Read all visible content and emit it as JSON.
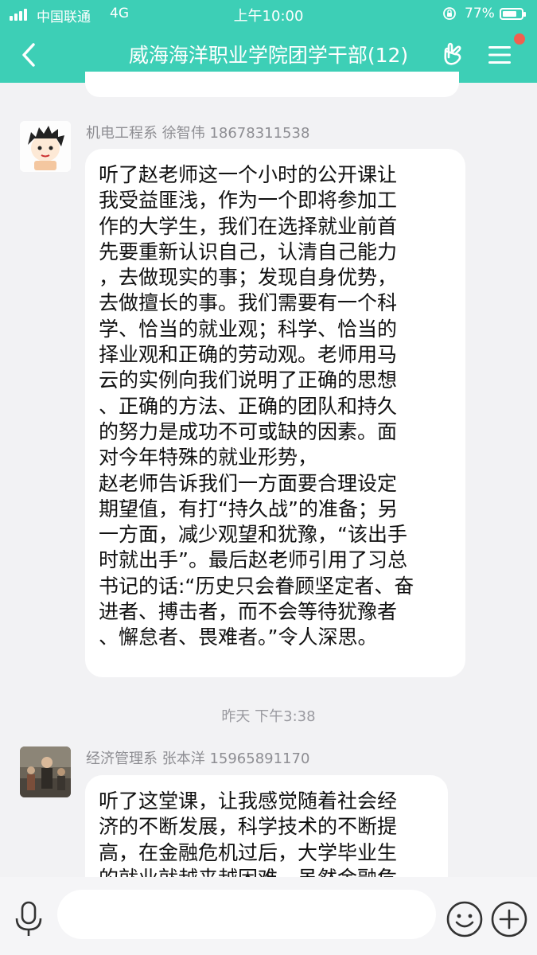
{
  "status_bar": {
    "carrier": "中国联通",
    "network": "4G",
    "time": "上午10:00",
    "battery": "77%",
    "battery_level": 0.77
  },
  "header": {
    "title": "威海海洋职业学院团学干部(12)",
    "icons": [
      "back-arrow-icon",
      "hand-gesture-icon",
      "menu-icon"
    ],
    "accent_color": "#3dcfb6",
    "badge_color": "#f0604f"
  },
  "messages": [
    {
      "sender": "机电工程系 徐智伟 18678311538",
      "lines": [
        "听了赵老师这一个小时的公开课让",
        "我受益匪浅，作为一个即将参加工",
        "作的大学生，我们在选择就业前首",
        "先要重新认识自己，认清自己能力",
        "，去做现实的事；发现自身优势，",
        "去做擅长的事。我们需要有一个科",
        "学、恰当的就业观；科学、恰当的",
        "择业观和正确的劳动观。老师用马",
        "云的实例向我们说明了正确的思想",
        "、正确的方法、正确的团队和持久",
        "的努力是成功不可或缺的因素。面",
        "对今年特殊的就业形势，",
        "赵老师告诉我们一方面要合理设定",
        "期望值，有打“持久战”的准备；另",
        "一方面，减少观望和犹豫，“该出手",
        "时就出手”。最后赵老师引用了习总",
        "书记的话:“历史只会眷顾坚定者、奋",
        "进者、搏击者，而不会等待犹豫者",
        "、懈怠者、畏难者。”令人深思。"
      ]
    },
    {
      "timestamp": "昨天 下午3:38",
      "sender": "经济管理系 张本洋  15965891170",
      "lines": [
        "听了这堂课，让我感觉随着社会经",
        "济的不断发展，科学技术的不断提",
        "高，在金融危机过后，大学毕业生",
        "的就业就越来越困难，虽然金融危"
      ]
    }
  ],
  "input_bar": {
    "placeholder": "",
    "icons": [
      "microphone-icon",
      "emoji-icon",
      "plus-icon"
    ]
  }
}
